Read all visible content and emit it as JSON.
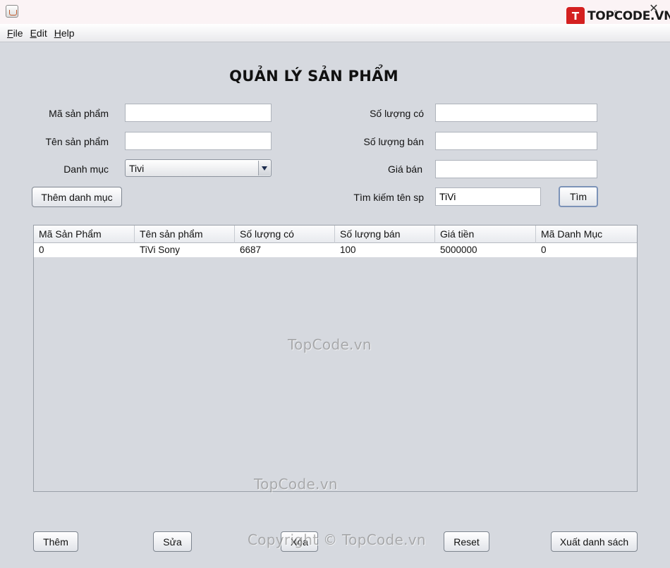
{
  "window": {
    "brand": "TOPCODE.VN",
    "brand_mark": "T"
  },
  "menu": [
    "File",
    "Edit",
    "Help"
  ],
  "title": "QUẢN LÝ SẢN PHẨM",
  "form": {
    "ma_san_pham": {
      "label": "Mã sản phẩm",
      "value": ""
    },
    "ten_san_pham": {
      "label": "Tên sản phẩm",
      "value": ""
    },
    "danh_muc": {
      "label": "Danh mục",
      "value": "Tivi"
    },
    "so_luong_co": {
      "label": "Số lượng có",
      "value": ""
    },
    "so_luong_ban": {
      "label": "Số lượng bán",
      "value": ""
    },
    "gia_ban": {
      "label": "Giá bán",
      "value": ""
    },
    "tim_kiem": {
      "label": "Tìm kiếm tên sp",
      "value": "TiVi"
    }
  },
  "buttons": {
    "them_danh_muc": "Thêm danh mục",
    "tim": "Tìm",
    "them": "Thêm",
    "sua": "Sửa",
    "xoa": "Xóa",
    "reset": "Reset",
    "xuat_danh_sach": "Xuất danh sách"
  },
  "table": {
    "columns": [
      "Mã Sản Phẩm",
      "Tên sản phẩm",
      "Số lượng có",
      "Số lượng bán",
      "Giá tiền",
      "Mã Danh Mục"
    ],
    "rows": [
      [
        "0",
        "TiVi Sony",
        "6687",
        "100",
        "5000000",
        "0"
      ]
    ]
  },
  "watermarks": {
    "center": "TopCode.vn",
    "lower": "TopCode.vn",
    "copyright": "Copyright © TopCode.vn"
  }
}
